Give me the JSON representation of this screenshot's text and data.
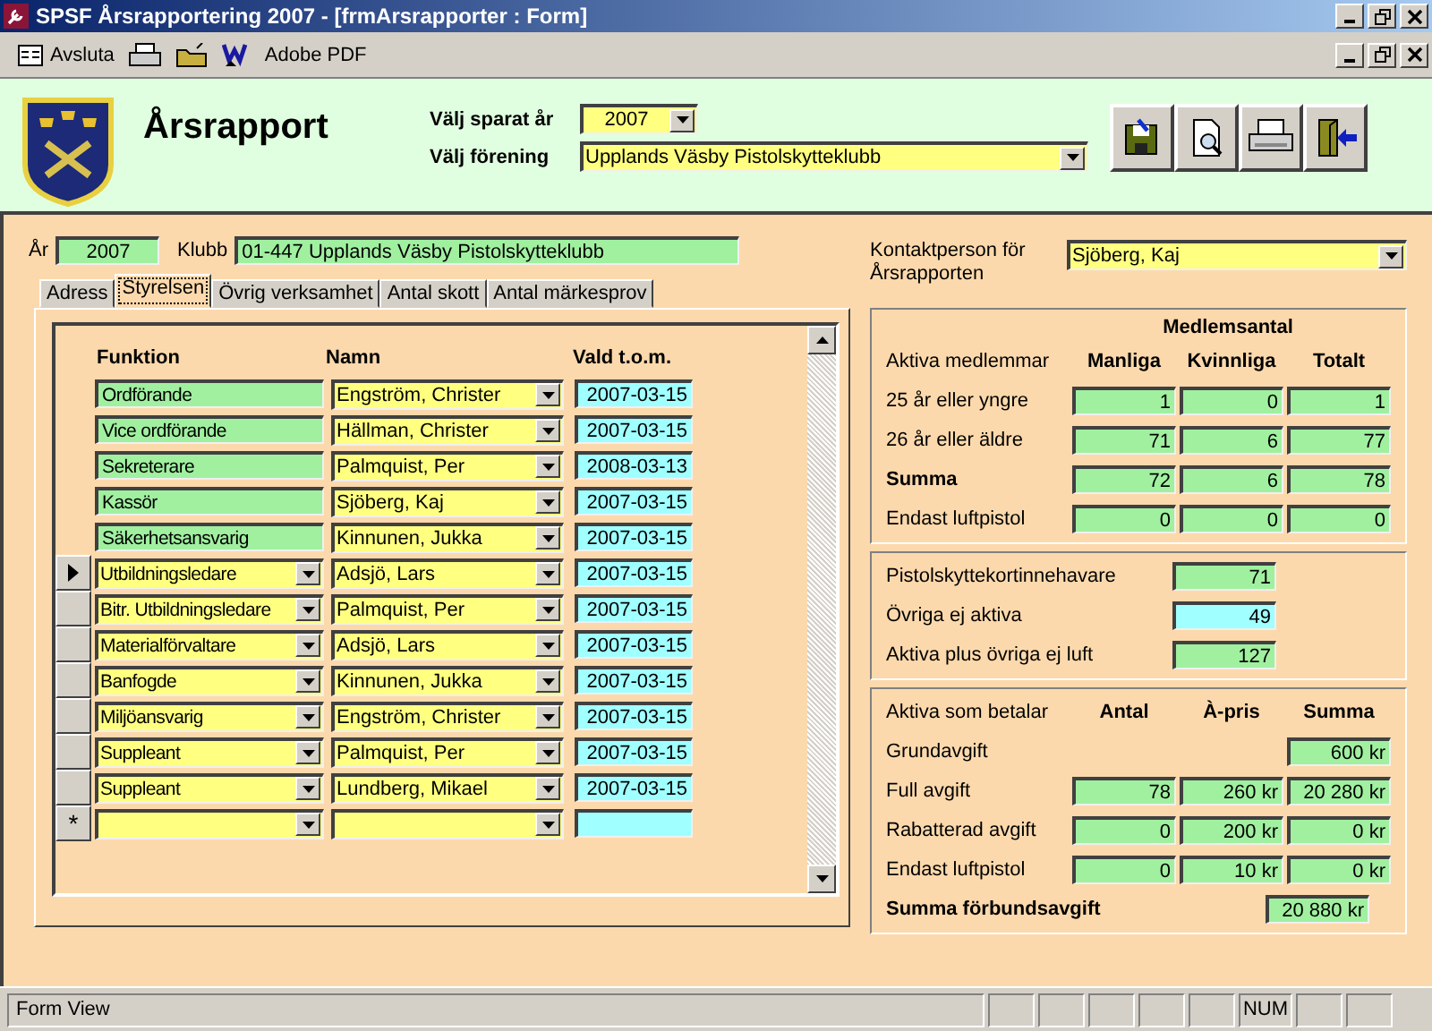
{
  "window": {
    "title": "SPSF Årsrapportering 2007 - [frmArsrapporter : Form]"
  },
  "toolbar": {
    "items": [
      {
        "kind": "exit",
        "label": "Avsluta"
      },
      {
        "kind": "print"
      },
      {
        "kind": "open"
      },
      {
        "kind": "word"
      },
      {
        "kind": "pdf",
        "label": "Adobe PDF"
      }
    ]
  },
  "header": {
    "title": "Årsrapport",
    "year_label": "Välj sparat år",
    "year": "2007",
    "club_label": "Välj förening",
    "club": "Upplands Väsby Pistolskytteklubb",
    "buttons": [
      {
        "kind": "save"
      },
      {
        "kind": "preview"
      },
      {
        "kind": "print"
      },
      {
        "kind": "close"
      }
    ]
  },
  "club_info": {
    "year_label": "År",
    "year": "2007",
    "club_label": "Klubb",
    "club": "01-447 Upplands Väsby Pistolskytteklubb"
  },
  "tabs": [
    {
      "label": "Adress",
      "selected": false
    },
    {
      "label": "Styrelsen",
      "selected": true
    },
    {
      "label": "Övrig verksamhet",
      "selected": false
    },
    {
      "label": "Antal skott",
      "selected": false
    },
    {
      "label": "Antal märkesprov",
      "selected": false
    }
  ],
  "board": {
    "columns": [
      "Funktion",
      "Namn",
      "Vald t.o.m."
    ],
    "rows": [
      {
        "kind": "fixed",
        "function": "Ordförande",
        "name": "Engström, Christer",
        "until": "2007-03-15",
        "selected": false
      },
      {
        "kind": "fixed",
        "function": "Vice ordförande",
        "name": "Hällman, Christer",
        "until": "2007-03-15",
        "selected": false
      },
      {
        "kind": "fixed",
        "function": "Sekreterare",
        "name": "Palmquist, Per",
        "until": "2008-03-13",
        "selected": false
      },
      {
        "kind": "fixed",
        "function": "Kassör",
        "name": "Sjöberg, Kaj",
        "until": "2007-03-15",
        "selected": false
      },
      {
        "kind": "fixed",
        "function": "Säkerhetsansvarig",
        "name": "Kinnunen, Jukka",
        "until": "2007-03-15",
        "selected": false
      },
      {
        "kind": "choice",
        "function": "Utbildningsledare",
        "name": "Adsjö, Lars",
        "until": "2007-03-15",
        "selected": true
      },
      {
        "kind": "choice",
        "function": "Bitr. Utbildningsledare",
        "name": "Palmquist, Per",
        "until": "2007-03-15",
        "selected": false
      },
      {
        "kind": "choice",
        "function": "Materialförvaltare",
        "name": "Adsjö, Lars",
        "until": "2007-03-15",
        "selected": false
      },
      {
        "kind": "choice",
        "function": "Banfogde",
        "name": "Kinnunen, Jukka",
        "until": "2007-03-15",
        "selected": false
      },
      {
        "kind": "choice",
        "function": "Miljöansvarig",
        "name": "Engström, Christer",
        "until": "2007-03-15",
        "selected": false
      },
      {
        "kind": "choice",
        "function": "Suppleant",
        "name": "Palmquist, Per",
        "until": "2007-03-15",
        "selected": false
      },
      {
        "kind": "choice",
        "function": "Suppleant",
        "name": "Lundberg, Mikael",
        "until": "2007-03-15",
        "selected": false
      }
    ],
    "new_row": {
      "marker": "*"
    }
  },
  "contact": {
    "label": "Kontaktperson för Årsrapporten",
    "value": "Sjöberg, Kaj"
  },
  "members": {
    "title": "Medlemsantal",
    "row_header": "Aktiva medlemmar",
    "columns": [
      "Manliga",
      "Kvinnliga",
      "Totalt"
    ],
    "rows": [
      {
        "kind": "plain",
        "label": "25 år eller yngre",
        "values": [
          "1",
          "0",
          "1"
        ]
      },
      {
        "kind": "plain",
        "label": "26 år eller äldre",
        "values": [
          "71",
          "6",
          "77"
        ]
      },
      {
        "kind": "total",
        "label": "Summa",
        "values": [
          "72",
          "6",
          "78"
        ]
      },
      {
        "kind": "plain",
        "label": "Endast luftpistol",
        "values": [
          "0",
          "0",
          "0"
        ]
      }
    ]
  },
  "other": {
    "rows": [
      {
        "label": "Pistolskyttekortinnehavare",
        "value": "71",
        "color": "#a0f0a0"
      },
      {
        "label": "Övriga ej aktiva",
        "value": "49",
        "color": "#a0ffff"
      },
      {
        "label": "Aktiva plus övriga ej luft",
        "value": "127",
        "color": "#a0f0a0"
      }
    ]
  },
  "fees": {
    "row_header": "Aktiva som betalar",
    "columns": [
      "Antal",
      "À-pris",
      "Summa"
    ],
    "rows": [
      {
        "label": "Grundavgift",
        "sum": "600 kr"
      },
      {
        "label": "Full avgift",
        "count": "78",
        "price": "260 kr",
        "sum": "20 280 kr"
      },
      {
        "label": "Rabatterad avgift",
        "count": "0",
        "price": "200 kr",
        "sum": "0 kr"
      },
      {
        "label": "Endast luftpistol",
        "count": "0",
        "price": "10 kr",
        "sum": "0 kr"
      }
    ],
    "total": {
      "label": "Summa förbundsavgift",
      "value": "20 880 kr"
    }
  },
  "status_bar": {
    "text": "Form View",
    "indicators": [
      "NUM"
    ]
  }
}
